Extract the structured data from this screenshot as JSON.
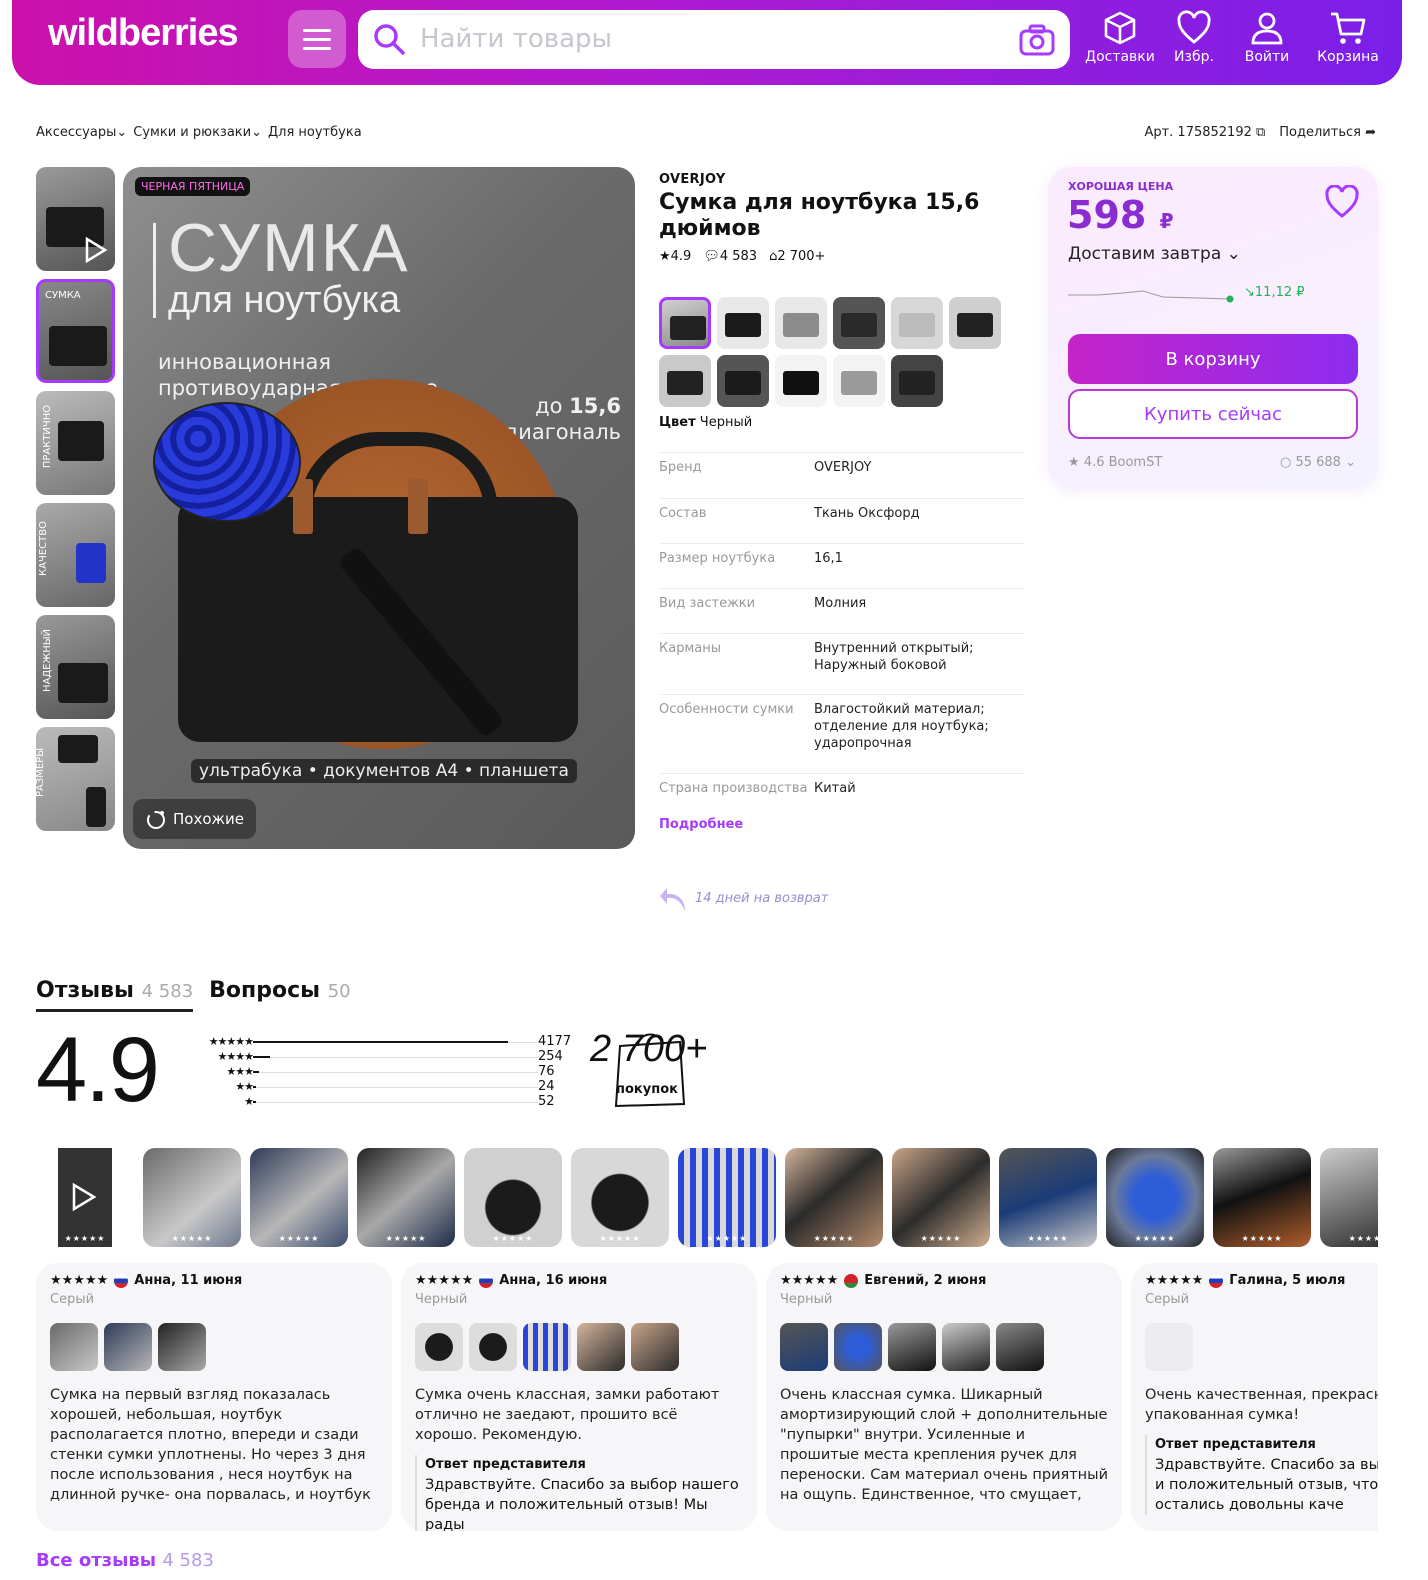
{
  "header": {
    "logo": "wildberries",
    "search_placeholder": "Найти товары",
    "nav": [
      "Доставки",
      "Избр.",
      "Войти",
      "Корзина"
    ]
  },
  "breadcrumbs": [
    "Аксессуары",
    "Сумки и рюкзаки",
    "Для ноутбука"
  ],
  "article": "Арт. 175852192",
  "share": "Поделиться",
  "gallery": {
    "badge": "ЧЕРНАЯ ПЯТНИЦА",
    "headline": "СУМКА",
    "subheadline": "для ноутбука",
    "feature": "инновационная противоударная система",
    "diagonal_pre": "до",
    "diagonal_val": "15,6",
    "diagonal_post": "диагональ",
    "caption": "ультрабука • документов А4 • планшета",
    "similar": "Похожие",
    "thumb_labels": [
      "",
      "СУМКА",
      "ПРАКТИЧНО",
      "КАЧЕСТВО",
      "НАДЕЖНЫЙ",
      "РАЗМЕРЫ"
    ]
  },
  "product": {
    "brand": "OVERJOY",
    "title": "Сумка для ноутбука 15,6 дюймов",
    "rating": "4.9",
    "reviews": "4 583",
    "bought": "2 700+",
    "color_label": "Цвет",
    "color_value": "Черный",
    "specs": [
      {
        "k": "Бренд",
        "v": "OVERJOY"
      },
      {
        "k": "Состав",
        "v": "Ткань Оксфорд"
      },
      {
        "k": "Размер ноутбука",
        "v": "16,1"
      },
      {
        "k": "Вид застежки",
        "v": "Молния"
      },
      {
        "k": "Карманы",
        "v": "Внутренний открытый; Наруж­ный боковой"
      },
      {
        "k": "Особенности сумки",
        "v": "Влагостойкий материал; отде­ление для ноутбука; ударопрочная"
      },
      {
        "k": "Страна производства",
        "v": "Китай"
      }
    ],
    "more": "Подробнее",
    "return": "14 дней на возврат"
  },
  "pricebox": {
    "good_price": "ХОРОШАЯ ЦЕНА",
    "price": "598",
    "currency": "₽",
    "delivery": "Доставим завтра",
    "change": "11,12 ₽",
    "cart": "В корзину",
    "buy_now": "Купить сейчас",
    "seller_rating": "4.6 BoomST",
    "seller_reviews": "55 688"
  },
  "tabs": [
    {
      "label": "Отзывы",
      "count": "4 583"
    },
    {
      "label": "Вопросы",
      "count": "50"
    }
  ],
  "rating_summary": {
    "score": "4.9",
    "bars": [
      {
        "stars": "★★★★★",
        "count": "4177",
        "share": 0.91
      },
      {
        "stars": "★★★★",
        "count": "254",
        "share": 0.06
      },
      {
        "stars": "★★★",
        "count": "76",
        "share": 0.02
      },
      {
        "stars": "★★",
        "count": "24",
        "share": 0.01
      },
      {
        "stars": "★",
        "count": "52",
        "share": 0.01
      }
    ],
    "purchases": "2 700+",
    "purchases_label": "покупок"
  },
  "review_photo_stars": "★★★★★",
  "reviews": [
    {
      "stars": "★★★★★",
      "author": "Анна, 11 июня",
      "color": "Серый",
      "text": "Сумка на первый взгляд показалась хорошей, небольшая, ноутбук располагается плотно, впереди и сзади стенки сумки уплотнены. Но через 3 дня после использования , неся ноутбук на длинной ручке- она порвалась, и ноутбук ударился об асфальт. От удара вмятина на"
    },
    {
      "stars": "★★★★★",
      "author": "Анна, 16 июня",
      "color": "Черный",
      "text": "Сумка очень классная, замки работают отлично не заедают, прошито всё хорошо. Рекомендую.",
      "answer_title": "Ответ представителя",
      "answer": "Здравствуйте. Спасибо за выбор нашего бренда и положительный отзыв! Мы рады"
    },
    {
      "stars": "★★★★★",
      "author": "Евгений, 2 июня",
      "color": "Черный",
      "text": "Очень классная сумка. Шикарный амортизирующий слой + дополнительные \"пупырки\" внутри. Усиленные и прошитые места крепления ручек для переноски. Сам материал очень приятный на ощупь. Единственное, что смущает, это пластиковые крепления ремня. Но"
    },
    {
      "stars": "★★★★★",
      "author": "Галина, 5 июля",
      "color": "Серый",
      "text": "Очень качественная, прекрасно упакованная сумка!",
      "answer_title": "Ответ представителя",
      "answer": "Здравствуйте. Спасибо за выбор бренда и положительный отзыв, что Вы остались довольны каче"
    }
  ],
  "all_reviews": "Все отзывы",
  "all_reviews_count": "4 583",
  "colors": {
    "accent": "#a73afd",
    "brand_gradient_start": "#cb11ab",
    "brand_gradient_end": "#7a1fe8",
    "green": "#23b35a"
  }
}
